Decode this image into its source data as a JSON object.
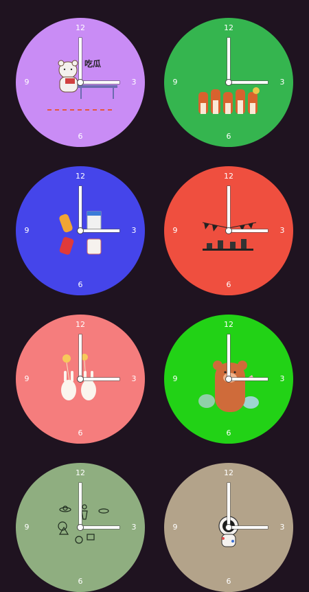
{
  "clocks": [
    {
      "id": "clock-1",
      "bg": "#c98cf5",
      "numbers": {
        "n12": "12",
        "n3": "3",
        "n6": "6",
        "n9": "9"
      },
      "illustration": "bear-eating-icon",
      "caption": "吃瓜"
    },
    {
      "id": "clock-2",
      "bg": "#35b54f",
      "numbers": {
        "n12": "12",
        "n3": "3",
        "n6": "6",
        "n9": "9"
      },
      "illustration": "foxes-icon"
    },
    {
      "id": "clock-3",
      "bg": "#4545ea",
      "numbers": {
        "n12": "12",
        "n3": "3",
        "n6": "6",
        "n9": "9"
      },
      "illustration": "drinks-icon"
    },
    {
      "id": "clock-4",
      "bg": "#ef4f3f",
      "numbers": {
        "n12": "12",
        "n3": "3",
        "n6": "6",
        "n9": "9"
      },
      "illustration": "party-shelf-icon"
    },
    {
      "id": "clock-5",
      "bg": "#f57d7d",
      "numbers": {
        "n12": "12",
        "n3": "3",
        "n6": "6",
        "n9": "9"
      },
      "illustration": "bunnies-balloons-icon"
    },
    {
      "id": "clock-6",
      "bg": "#22d216",
      "numbers": {
        "n12": "12",
        "n3": "3",
        "n6": "6",
        "n9": "9"
      },
      "illustration": "bear-waving-icon"
    },
    {
      "id": "clock-7",
      "bg": "#8fae80",
      "numbers": {
        "n12": "12",
        "n3": "3",
        "n6": "6",
        "n9": "9"
      },
      "illustration": "space-doodles-icon"
    },
    {
      "id": "clock-8",
      "bg": "#b3a38a",
      "numbers": {
        "n12": "12",
        "n3": "3",
        "n6": "6",
        "n9": "9"
      },
      "illustration": "astronaut-icon"
    }
  ]
}
